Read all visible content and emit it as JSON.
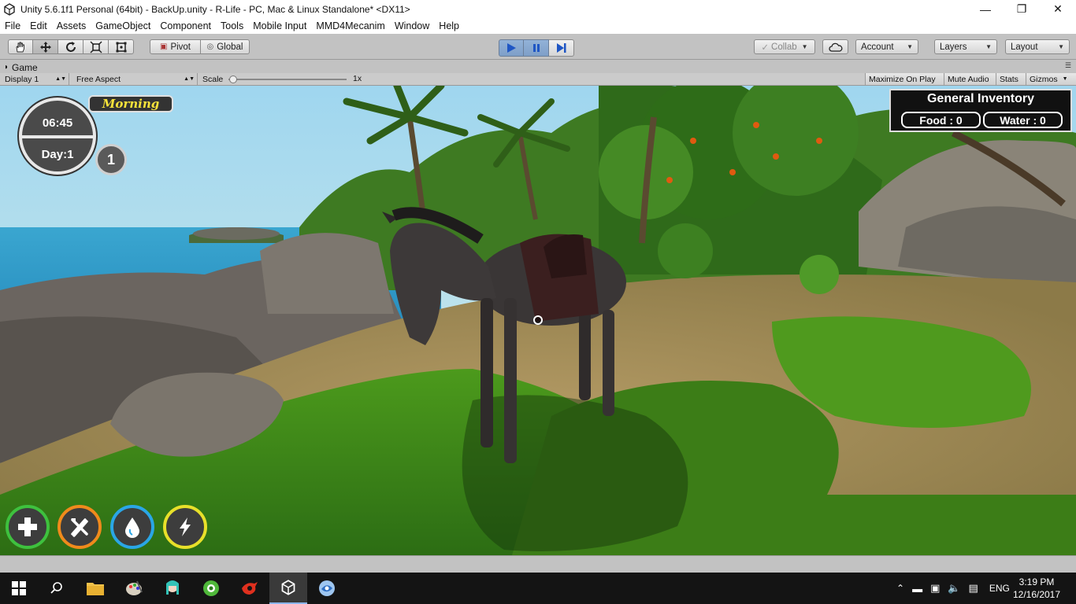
{
  "window": {
    "title": "Unity 5.6.1f1 Personal (64bit) - BackUp.unity - R-Life - PC, Mac & Linux Standalone* <DX11>",
    "controls": [
      "minimize-icon",
      "restore-icon",
      "close-icon"
    ]
  },
  "menu": [
    "File",
    "Edit",
    "Assets",
    "GameObject",
    "Component",
    "Tools",
    "Mobile Input",
    "MMD4Mecanim",
    "Window",
    "Help"
  ],
  "toolbar": {
    "tools": [
      "hand-icon",
      "move-icon",
      "rotate-icon",
      "scale-icon",
      "rect-icon"
    ],
    "pivot_label": "Pivot",
    "global_label": "Global",
    "play_controls": [
      "play-icon",
      "pause-icon",
      "step-icon"
    ],
    "collab_label": "Collab",
    "account_label": "Account",
    "layers_label": "Layers",
    "layout_label": "Layout"
  },
  "game_tab": {
    "label": "Game",
    "display_label": "Display 1",
    "aspect_label": "Free Aspect",
    "scale_label": "Scale",
    "scale_value": "1x",
    "maximize_label": "Maximize On Play",
    "mute_label": "Mute Audio",
    "stats_label": "Stats",
    "gizmos_label": "Gizmos"
  },
  "hud": {
    "time": "06:45",
    "day": "Day:1",
    "period": "Morning",
    "day_count": "1",
    "inventory_title": "General Inventory",
    "food": "Food : 0",
    "water": "Water : 0",
    "stat_buttons": [
      {
        "name": "health",
        "icon": "plus-icon",
        "color": "#3ec13e"
      },
      {
        "name": "hunger",
        "icon": "fork-knife-icon",
        "color": "#f08a1c"
      },
      {
        "name": "thirst",
        "icon": "water-drop-icon",
        "color": "#2aa6e6"
      },
      {
        "name": "energy",
        "icon": "lightning-icon",
        "color": "#e8e02a"
      }
    ]
  },
  "taskbar": {
    "apps": [
      "windows-start-icon",
      "search-icon",
      "file-explorer-icon",
      "paint-icon",
      "miku-app-icon",
      "green-app-icon",
      "garena-icon",
      "unity-icon",
      "blue-app-icon"
    ],
    "language": "ENG",
    "time": "3:19 PM",
    "date": "12/16/2017"
  }
}
